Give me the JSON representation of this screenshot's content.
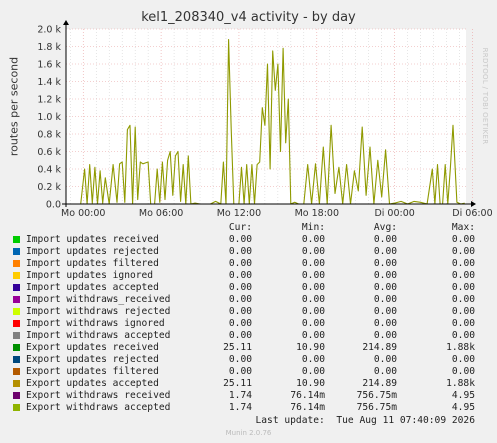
{
  "window": {
    "title": "kel1_208340_v4 activity - by day",
    "side_label": "RRDTOOL / TOBI OETIKER",
    "footer": "Munin 2.0.76",
    "last_update": "Last update:  Tue Aug 11 07:40:09 2026"
  },
  "colors": {
    "background": "#f0f0f0",
    "plot_background": "#ffffff",
    "grid_major": "#e8a0a0",
    "grid_minor": "#cccccc",
    "line": "#8f9a00"
  },
  "chart_data": {
    "type": "line",
    "title": "kel1_208340_v4 activity - by day",
    "xlabel": "",
    "ylabel": "routes per second",
    "ylim": [
      0,
      2000
    ],
    "yticks": [
      0,
      200,
      400,
      600,
      800,
      1000,
      1200,
      1400,
      1600,
      1800,
      2000
    ],
    "ytick_labels": [
      "0.0",
      "0.2 k",
      "0.4 k",
      "0.6 k",
      "0.8 k",
      "1.0 k",
      "1.2 k",
      "1.4 k",
      "1.6 k",
      "1.8 k",
      "2.0 k"
    ],
    "xlim_hours": [
      -1.33,
      29.5
    ],
    "xticks_hours": [
      0,
      6,
      12,
      18,
      24,
      30
    ],
    "xtick_labels": [
      "Mo 00:00",
      "Mo 06:00",
      "Mo 12:00",
      "Mo 18:00",
      "Di 00:00",
      "Di 06:00"
    ],
    "grid": true,
    "series": [
      {
        "name": "Export updates accepted",
        "color": "#8f9a00",
        "x_hours": [
          -0.2,
          0.1,
          0.3,
          0.5,
          0.7,
          0.9,
          1.1,
          1.3,
          1.5,
          1.7,
          2.0,
          2.3,
          2.6,
          2.8,
          3.0,
          3.2,
          3.4,
          3.6,
          3.8,
          4.0,
          4.2,
          4.4,
          4.6,
          4.8,
          5.0,
          5.2,
          5.5,
          5.7,
          5.9,
          6.1,
          6.3,
          6.5,
          6.7,
          6.9,
          7.1,
          7.3,
          7.5,
          7.7,
          7.9,
          8.1,
          8.3,
          8.6,
          9.0,
          9.4,
          9.8,
          10.2,
          10.6,
          10.8,
          11.0,
          11.2,
          11.4,
          11.6,
          11.8,
          12.0,
          12.2,
          12.4,
          12.6,
          12.8,
          13.0,
          13.2,
          13.4,
          13.6,
          13.8,
          14.0,
          14.2,
          14.4,
          14.6,
          14.8,
          15.0,
          15.2,
          15.4,
          15.6,
          15.8,
          16.0,
          16.3,
          16.6,
          17.0,
          17.3,
          17.6,
          17.9,
          18.2,
          18.5,
          18.8,
          19.1,
          19.4,
          19.7,
          20.0,
          20.3,
          20.6,
          20.9,
          21.2,
          21.5,
          21.8,
          22.1,
          22.4,
          22.7,
          23.0,
          23.3,
          23.6,
          24.0,
          24.5,
          25.0,
          25.5,
          26.0,
          26.5,
          26.9,
          27.1,
          27.3,
          27.5,
          27.7,
          27.9,
          28.1,
          28.3,
          28.5,
          28.8,
          29.1,
          29.4
        ],
        "y": [
          0,
          400,
          0,
          450,
          10,
          420,
          0,
          380,
          10,
          300,
          0,
          450,
          20,
          460,
          480,
          20,
          850,
          900,
          0,
          880,
          50,
          480,
          460,
          470,
          480,
          0,
          0,
          400,
          20,
          480,
          50,
          500,
          600,
          100,
          550,
          600,
          30,
          450,
          0,
          550,
          0,
          10,
          0,
          0,
          0,
          30,
          0,
          480,
          0,
          1880,
          860,
          0,
          0,
          0,
          420,
          0,
          450,
          0,
          450,
          0,
          450,
          480,
          1100,
          900,
          1600,
          400,
          1750,
          1300,
          1600,
          600,
          1780,
          700,
          1200,
          0,
          20,
          0,
          0,
          450,
          0,
          460,
          0,
          650,
          0,
          900,
          120,
          420,
          0,
          450,
          0,
          380,
          150,
          880,
          100,
          650,
          0,
          500,
          80,
          620,
          0,
          10,
          30,
          0,
          30,
          20,
          0,
          400,
          0,
          450,
          0,
          0,
          450,
          0,
          420,
          900,
          20,
          0,
          10
        ]
      }
    ]
  },
  "legend": {
    "headers": {
      "cur": "Cur:",
      "min": "Min:",
      "avg": "Avg:",
      "max": "Max:"
    },
    "rows": [
      {
        "name": "Import updates received",
        "color": "#00cc00",
        "cur": "0.00",
        "min": "0.00",
        "avg": "0.00",
        "max": "0.00"
      },
      {
        "name": "Import updates rejected",
        "color": "#0066b3",
        "cur": "0.00",
        "min": "0.00",
        "avg": "0.00",
        "max": "0.00"
      },
      {
        "name": "Import updates filtered",
        "color": "#ff8000",
        "cur": "0.00",
        "min": "0.00",
        "avg": "0.00",
        "max": "0.00"
      },
      {
        "name": "Import updates ignored",
        "color": "#ffcc00",
        "cur": "0.00",
        "min": "0.00",
        "avg": "0.00",
        "max": "0.00"
      },
      {
        "name": "Import updates accepted",
        "color": "#330099",
        "cur": "0.00",
        "min": "0.00",
        "avg": "0.00",
        "max": "0.00"
      },
      {
        "name": "Import withdraws_received",
        "color": "#990099",
        "cur": "0.00",
        "min": "0.00",
        "avg": "0.00",
        "max": "0.00"
      },
      {
        "name": "Import withdraws rejected",
        "color": "#ccff00",
        "cur": "0.00",
        "min": "0.00",
        "avg": "0.00",
        "max": "0.00"
      },
      {
        "name": "Import withdraws ignored",
        "color": "#ff0000",
        "cur": "0.00",
        "min": "0.00",
        "avg": "0.00",
        "max": "0.00"
      },
      {
        "name": "Import withdraws accepted",
        "color": "#808080",
        "cur": "0.00",
        "min": "0.00",
        "avg": "0.00",
        "max": "0.00"
      },
      {
        "name": "Export updates received",
        "color": "#008f00",
        "cur": "25.11",
        "min": "10.90",
        "avg": "214.89",
        "max": "1.88k"
      },
      {
        "name": "Export updates rejected",
        "color": "#00487d",
        "cur": "0.00",
        "min": "0.00",
        "avg": "0.00",
        "max": "0.00"
      },
      {
        "name": "Export updates filtered",
        "color": "#b35a00",
        "cur": "0.00",
        "min": "0.00",
        "avg": "0.00",
        "max": "0.00"
      },
      {
        "name": "Export updates accepted",
        "color": "#b38f00",
        "cur": "25.11",
        "min": "10.90",
        "avg": "214.89",
        "max": "1.88k"
      },
      {
        "name": "Export withdraws received",
        "color": "#6b006b",
        "cur": "1.74",
        "min": "76.14m",
        "avg": "756.75m",
        "max": "4.95"
      },
      {
        "name": "Export withdraws accepted",
        "color": "#8fb300",
        "cur": "1.74",
        "min": "76.14m",
        "avg": "756.75m",
        "max": "4.95"
      }
    ]
  }
}
